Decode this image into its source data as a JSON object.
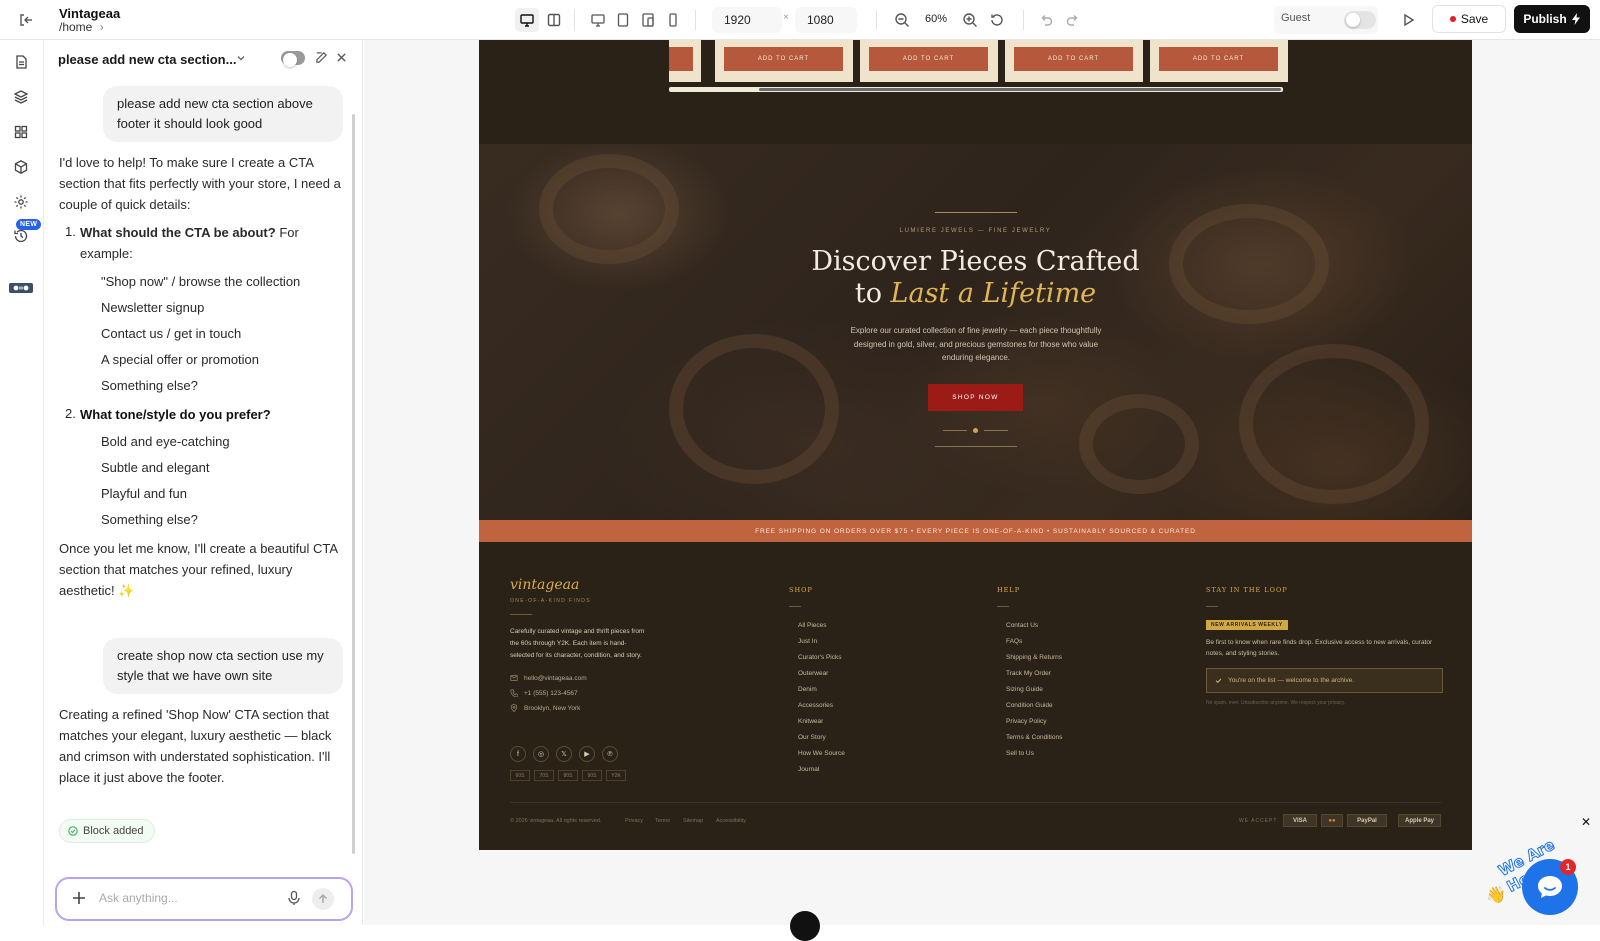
{
  "header": {
    "app_title": "Vintageaa",
    "path": "/home",
    "path_chevron": "›",
    "width_value": "1920",
    "times": "×",
    "height_value": "1080",
    "zoom": "60%",
    "guest_label": "Guest",
    "save_label": "Save",
    "publish_label": "Publish"
  },
  "rail": {
    "new_badge": "NEW"
  },
  "chat": {
    "title": "please add new cta section...",
    "user_message_1": "please add new cta section above footer it should look good",
    "assistant_intro": "I'd love to help! To make sure I create a CTA section that fits perfectly with your store, I need a couple of quick details:",
    "q1_num": "1.",
    "q1_bold": "What should the CTA be about?",
    "q1_rest": " For example:",
    "q1_options": [
      "\"Shop now\" / browse the collection",
      "Newsletter signup",
      "Contact us / get in touch",
      "A special offer or promotion",
      "Something else?"
    ],
    "q2_num": "2.",
    "q2_bold": "What tone/style do you prefer?",
    "q2_options": [
      "Bold and eye-catching",
      "Subtle and elegant",
      "Playful and fun",
      "Something else?"
    ],
    "assistant_outro": "Once you let me know, I'll create a beautiful CTA section that matches your refined, luxury aesthetic! ✨",
    "user_message_2": "create shop now cta section use my style that we have own site",
    "assistant_reply": "Creating a refined 'Shop Now' CTA section that matches your elegant, luxury aesthetic — black and crimson with understated sophistication. I'll place it just above the footer.",
    "block_added": "Block added",
    "input_placeholder": "Ask anything..."
  },
  "site": {
    "product_button": "ADD TO CART",
    "hero": {
      "eyebrow": "LUMIERE JEWELS — FINE JEWELRY",
      "title_line1": "Discover Pieces Crafted",
      "title_to": "to ",
      "title_accent": "Last a Lifetime",
      "description": "Explore our curated collection of fine jewelry — each piece thoughtfully designed in gold, silver, and precious gemstones for those who value enduring elegance.",
      "cta": "SHOP NOW"
    },
    "announcement": "FREE SHIPPING ON ORDERS OVER $75  •  EVERY PIECE IS ONE-OF-A-KIND  •  SUSTAINABLY SOURCED & CURATED",
    "footer": {
      "brand": "vintageaa",
      "brand_sub": "ONE-OF-A-KIND FINDS",
      "about": "Carefully curated vintage and thrift pieces from the 60s through Y2K. Each item is hand-selected for its character, condition, and story.",
      "email": "hello@vintageaa.com",
      "phone": "+1 (555) 123-4567",
      "location": "Brooklyn, New York",
      "socials": [
        "f",
        "◎",
        "𝕏",
        "▶",
        "℗"
      ],
      "eras": [
        "60S",
        "70S",
        "80S",
        "90S",
        "Y2K"
      ],
      "shop_heading": "SHOP",
      "shop_links": [
        "All Pieces",
        "Just In",
        "Curator's Picks",
        "Outerwear",
        "Denim",
        "Accessories",
        "Knitwear",
        "Our Story",
        "How We Source",
        "Journal"
      ],
      "help_heading": "HELP",
      "help_links": [
        "Contact Us",
        "FAQs",
        "Shipping & Returns",
        "Track My Order",
        "Sizing Guide",
        "Condition Guide",
        "Privacy Policy",
        "Terms & Conditions",
        "Sell to Us"
      ],
      "newsletter_heading": "STAY IN THE LOOP",
      "newsletter_badge": "NEW ARRIVALS WEEKLY",
      "newsletter_text": "Be first to know when rare finds drop. Exclusive access to new arrivals, curator notes, and styling stories.",
      "newsletter_success": "You're on the list — welcome to the archive.",
      "newsletter_note": "No spam, ever. Unsubscribe anytime. We respect your privacy.",
      "copyright": "© 2026 vintageaa. All rights reserved.",
      "legal_links": [
        "Privacy",
        "Terms",
        "Sitemap",
        "Accessibility"
      ],
      "we_accept": "WE ACCEPT",
      "payments": [
        "VISA",
        "●●",
        "PayPal",
        "Apple Pay"
      ]
    }
  },
  "widget": {
    "tagline": "We Are Here!",
    "badge_count": "1",
    "close": "✕"
  }
}
